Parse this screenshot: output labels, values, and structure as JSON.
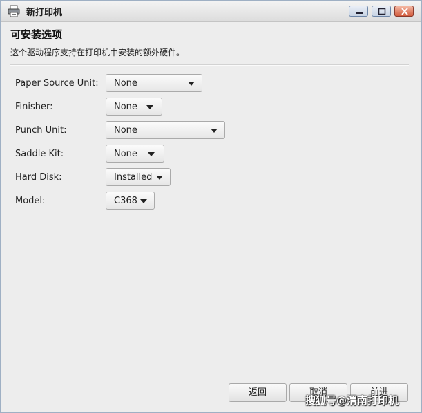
{
  "window": {
    "title": "新打印机",
    "controls": [
      "minimize",
      "maximize",
      "close"
    ]
  },
  "page": {
    "heading": "可安装选项",
    "description": "这个驱动程序支持在打印机中安装的额外硬件。"
  },
  "options": [
    {
      "label": "Paper Source Unit:",
      "value": "None"
    },
    {
      "label": "Finisher:",
      "value": "None"
    },
    {
      "label": "Punch Unit:",
      "value": "None"
    },
    {
      "label": "Saddle Kit:",
      "value": "None"
    },
    {
      "label": "Hard Disk:",
      "value": "Installed"
    },
    {
      "label": "Model:",
      "value": "C368"
    }
  ],
  "buttons": {
    "back": "返回",
    "cancel": "取消",
    "forward": "前进"
  },
  "watermark": "搜狐号@渭南打印机"
}
